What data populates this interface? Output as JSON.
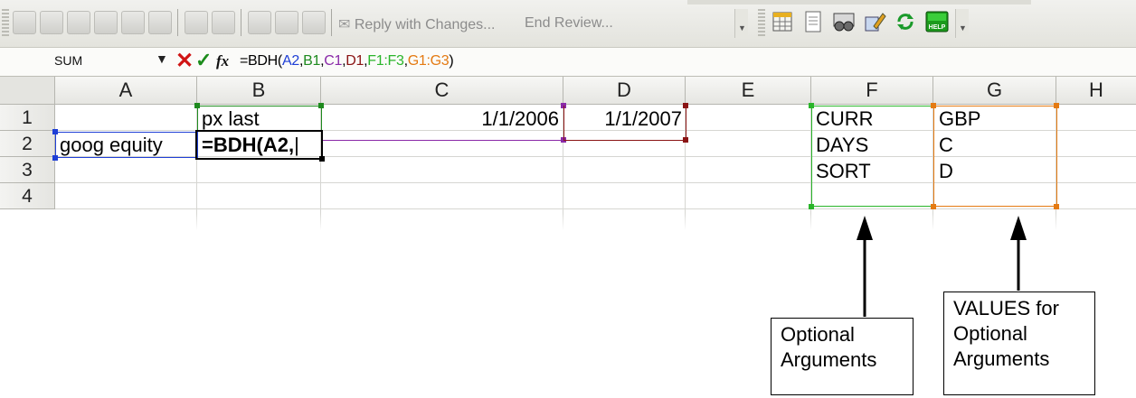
{
  "toolbar": {
    "reply_label": "Reply with Changes...",
    "end_review_label": "End Review..."
  },
  "formula_bar": {
    "name_box": "SUM",
    "formula_prefix": "=BDH(",
    "ref_a2": "A2",
    "ref_b1": "B1",
    "ref_c1": "C1",
    "ref_d1": "D1",
    "ref_f": "F1:F3",
    "ref_g": "G1:G3",
    "comma": ",",
    "close": ")"
  },
  "columns": [
    "A",
    "B",
    "C",
    "D",
    "E",
    "F",
    "G",
    "H"
  ],
  "rows": [
    "1",
    "2",
    "3",
    "4"
  ],
  "cells": {
    "B1": "px last",
    "C1": "1/1/2006",
    "D1": "1/1/2007",
    "A2": "goog equity",
    "B2": "=BDH(A2,",
    "F1": "CURR",
    "F2": "DAYS",
    "F3": "SORT",
    "G1": "GBP",
    "G2": "C",
    "G3": "D"
  },
  "callouts": {
    "left_line1": "Optional",
    "left_line2": "Arguments",
    "right_line1": "VALUES for",
    "right_line2": "Optional",
    "right_line3": "Arguments"
  },
  "colors": {
    "ref_a2": "#1f3fd6",
    "ref_b1": "#1e8a1e",
    "ref_c1": "#8a2aa8",
    "ref_d1": "#8a1414",
    "ref_f": "#2ab52a",
    "ref_g": "#e47a12"
  }
}
